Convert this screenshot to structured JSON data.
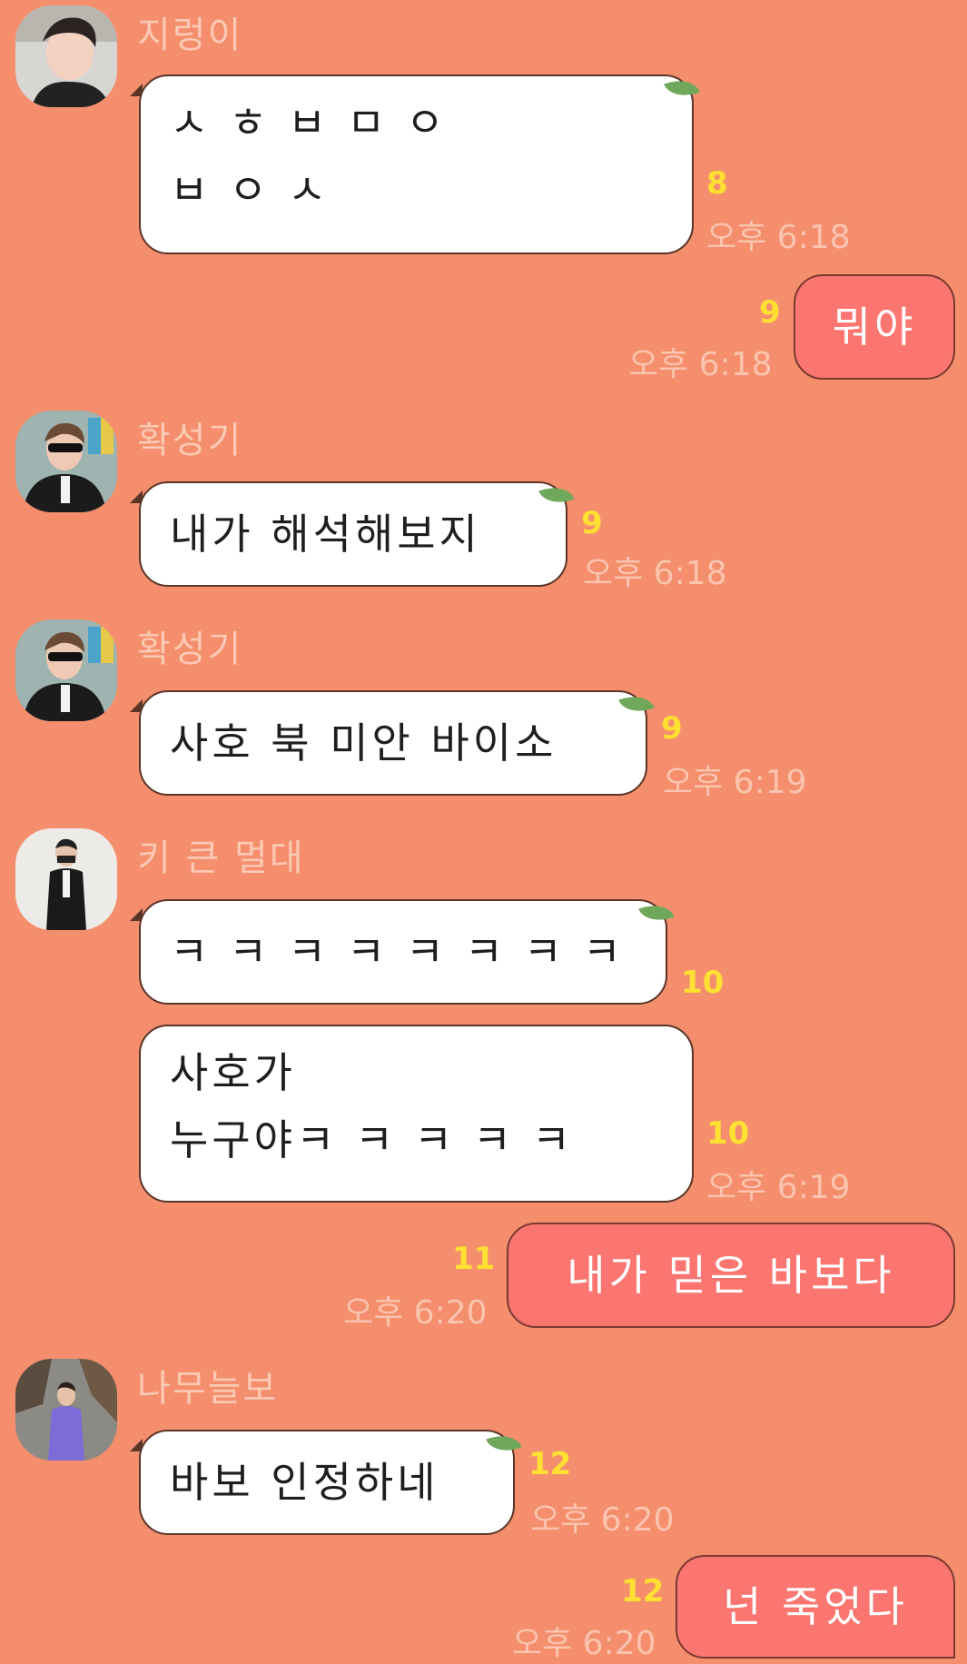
{
  "colors": {
    "background": "#f48e6c",
    "incoming_bubble": "#ffffff",
    "outgoing_bubble": "#fb7671",
    "unread_count": "#ffe033",
    "timestamp": "#fbc4ae",
    "sender_name": "#fbc9b4"
  },
  "messages": [
    {
      "sender": "지렁이",
      "text": "ㅅ ㅎ ㅂ ㅁ ㅇ\nㅂ ㅇ ㅅ",
      "count": "8",
      "time": "오후 6:18"
    },
    {
      "sender": "",
      "text": "뭐야",
      "count": "9",
      "time": "오후 6:18",
      "outgoing": true
    },
    {
      "sender": "확성기",
      "text": "내가 해석해보지",
      "count": "9",
      "time": "오후 6:18"
    },
    {
      "sender": "확성기",
      "text": "사호 북 미안 바이소",
      "count": "9",
      "time": "오후 6:19"
    },
    {
      "sender": "키 큰 멀대",
      "text": "ㅋ ㅋ ㅋ ㅋ ㅋ ㅋ ㅋ ㅋ",
      "count": "10",
      "time": ""
    },
    {
      "sender": "",
      "text": "사호가\n누구야ㅋ ㅋ ㅋ ㅋ ㅋ",
      "count": "10",
      "time": "오후 6:19"
    },
    {
      "sender": "",
      "text": "내가 믿은 바보다",
      "count": "11",
      "time": "오후 6:20",
      "outgoing": true
    },
    {
      "sender": "나무늘보",
      "text": "바보 인정하네",
      "count": "12",
      "time": "오후 6:20"
    },
    {
      "sender": "",
      "text": "넌 죽었다",
      "count": "12",
      "time": "오후 6:20",
      "outgoing": true
    }
  ]
}
